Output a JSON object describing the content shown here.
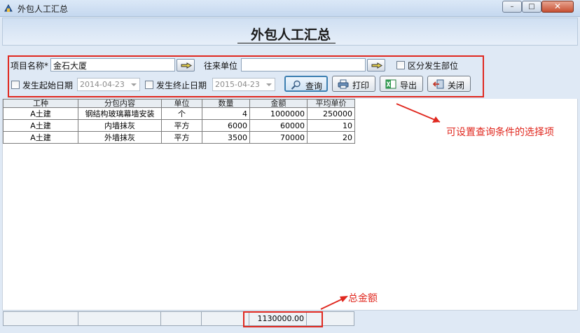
{
  "window": {
    "title": "外包人工汇总",
    "min_glyph": "–",
    "max_glyph": "□",
    "close_glyph": "✕"
  },
  "header": {
    "title": "外包人工汇总"
  },
  "filters": {
    "project_label": "项目名称*",
    "project_value": "金石大厦",
    "partner_label": "往来单位",
    "partner_value": "",
    "by_location_label": "区分发生部位",
    "start_label": "发生起始日期",
    "start_date": "2014-04-23",
    "end_label": "发生终止日期",
    "end_date": "2015-04-23"
  },
  "buttons": {
    "query": "查询",
    "print": "打印",
    "export": "导出",
    "close": "关闭"
  },
  "table": {
    "columns": [
      "工种",
      "分包内容",
      "单位",
      "数量",
      "金额",
      "平均单价"
    ],
    "rows": [
      [
        "A土建",
        "钢结构玻璃幕墙安装",
        "个",
        "4",
        "1000000",
        "250000"
      ],
      [
        "A土建",
        "内墙抹灰",
        "平方",
        "6000",
        "60000",
        "10"
      ],
      [
        "A土建",
        "外墙抹灰",
        "平方",
        "3500",
        "70000",
        "20"
      ]
    ]
  },
  "summary": {
    "total_amount": "1130000.00"
  },
  "annotations": {
    "filter_note": "可设置查询条件的选择项",
    "total_note": "总金额"
  },
  "colors": {
    "annotation_red": "#e0281f",
    "background": "#dfe9f5"
  }
}
